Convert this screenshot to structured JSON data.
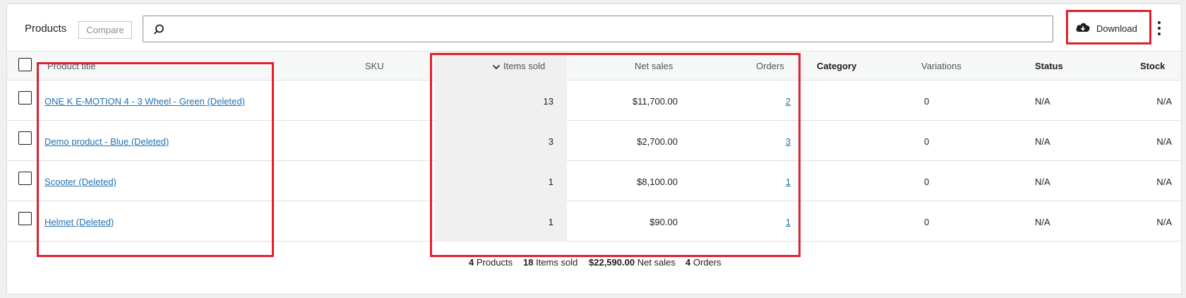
{
  "header": {
    "title": "Products",
    "compare_label": "Compare",
    "search_value": "",
    "download_label": "Download"
  },
  "columns": {
    "product_title": "Product title",
    "sku": "SKU",
    "items_sold": "Items sold",
    "net_sales": "Net sales",
    "orders": "Orders",
    "category": "Category",
    "variations": "Variations",
    "status": "Status",
    "stock": "Stock"
  },
  "rows": [
    {
      "title": "ONE K E-MOTION 4 - 3 Wheel - Green (Deleted)",
      "sku": "",
      "items_sold": "13",
      "net_sales": "$11,700.00",
      "orders": "2",
      "category": "",
      "variations": "0",
      "status": "N/A",
      "stock": "N/A"
    },
    {
      "title": "Demo product - Blue (Deleted)",
      "sku": "",
      "items_sold": "3",
      "net_sales": "$2,700.00",
      "orders": "3",
      "category": "",
      "variations": "0",
      "status": "N/A",
      "stock": "N/A"
    },
    {
      "title": "Scooter (Deleted)",
      "sku": "",
      "items_sold": "1",
      "net_sales": "$8,100.00",
      "orders": "1",
      "category": "",
      "variations": "0",
      "status": "N/A",
      "stock": "N/A"
    },
    {
      "title": "Helmet (Deleted)",
      "sku": "",
      "items_sold": "1",
      "net_sales": "$90.00",
      "orders": "1",
      "category": "",
      "variations": "0",
      "status": "N/A",
      "stock": "N/A"
    }
  ],
  "summary": {
    "products_count": "4",
    "products_label": "Products",
    "items_sold_count": "18",
    "items_sold_label": "Items sold",
    "net_sales_value": "$22,590.00",
    "net_sales_label": "Net sales",
    "orders_count": "4",
    "orders_label": "Orders"
  },
  "icons": {
    "search": "search-icon",
    "download": "cloud-download-icon",
    "more": "more-vertical-icon",
    "sort": "chevron-down-icon"
  },
  "colors": {
    "highlight": "#e0202e",
    "link": "#2271b1",
    "sorted_column": "#f0f0f0"
  }
}
